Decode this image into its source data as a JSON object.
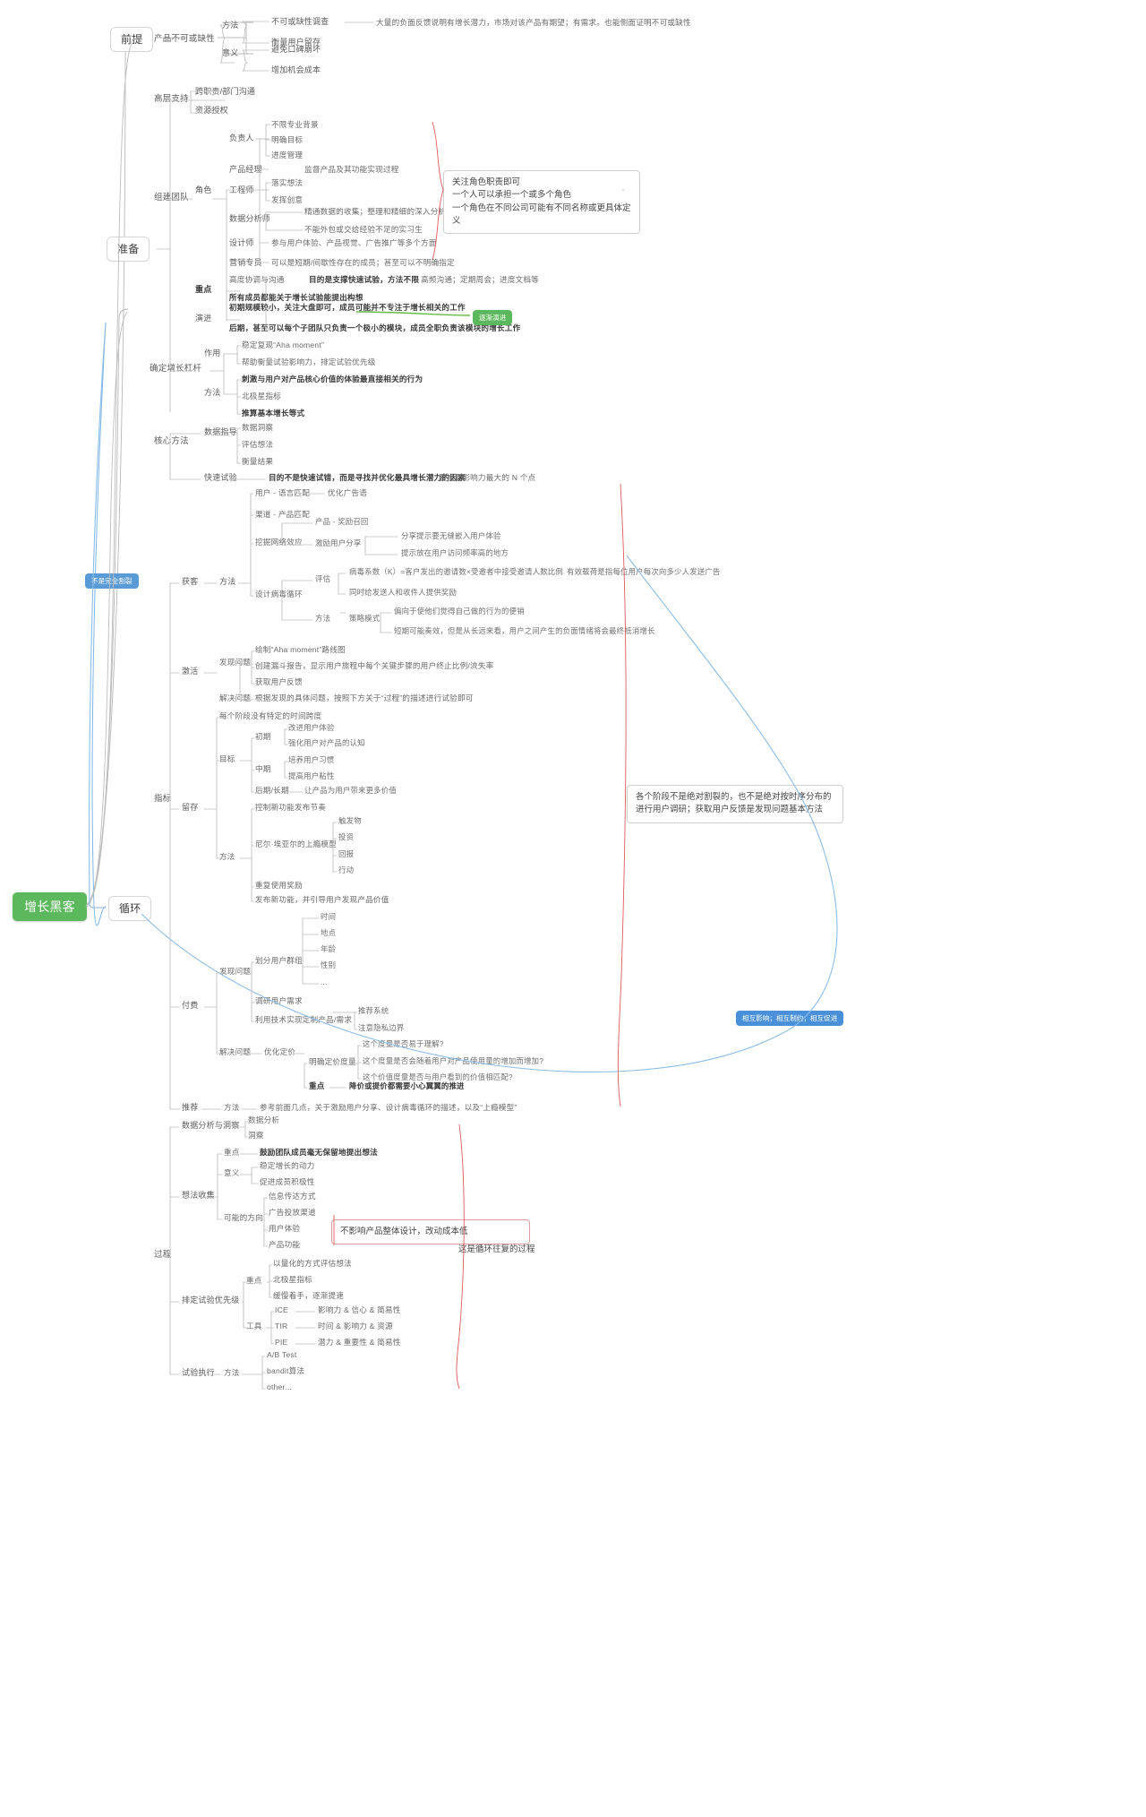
{
  "title": "增长黑客",
  "colors": {
    "root_green": "#5cb85c",
    "badge_blue": "#5b9bd5",
    "note_border": "#cfcfcf",
    "red_brace": "#e05c5c",
    "blue_curve": "#7fb6e8",
    "green_arrow": "#66bb44"
  },
  "root": {
    "label": "增长黑客"
  },
  "branches": {
    "premise": {
      "label": "前提"
    },
    "prepare": {
      "label": "准备"
    },
    "loop": {
      "label": "循环"
    }
  },
  "nodes": {
    "n_product_essential": "产品不可或缺性",
    "n_method": "方法",
    "n_survey": "不可或缺性调查",
    "n_survey_note": "大量的负面反馈说明有增长潜力，市场对该产品有期望；有需求。也能侧面证明不可或缺性",
    "n_measure_retention": "衡量用户留存",
    "n_meaning": "意义",
    "n_avoid_wom": "避免口碑崩坏",
    "n_opportunity_cost": "增加机会成本",
    "n_top_support": "高层支持",
    "n_cross_dept": "跨职责/部门沟通",
    "n_resource": "资源授权",
    "n_build_team": "组建团队",
    "n_role": "角色",
    "n_owner": "负责人",
    "n_owner_1": "不限专业背景",
    "n_owner_2": "明确目标",
    "n_owner_3": "进度管理",
    "n_pm": "产品经理",
    "n_pm_1": "监督产品及其功能实现过程",
    "n_eng": "工程师",
    "n_eng_1": "落实想法",
    "n_eng_2": "发挥创意",
    "n_data_analyst": "数据分析师",
    "n_da_1": "精通数据的收集；整理和精细的深入分析",
    "n_da_2": "不能外包或交给经验不足的实习生",
    "n_designer": "设计师",
    "n_designer_1": "参与用户体验、产品视觉、广告推广等多个方面",
    "n_marketer": "营销专员",
    "n_marketer_1": "可以是短期/间歇性存在的成员；甚至可以不明确指定",
    "n_focus": "重点",
    "n_focus_1": "高度协调与沟通",
    "n_focus_1a": "目的是支撑快速试验，方法不限",
    "n_focus_1b": "高频沟通；定期周会；进度文档等",
    "n_focus_2": "所有成员都能关于增长试验能提出构想",
    "n_evolve": "演进",
    "n_evolve_1": "初期规模较小，关注大盘即可，成员可能并不专注于增长相关的工作",
    "n_evolve_2": "后期，甚至可以每个子团队只负责一个极小的模块，成员全职负责该模块的增长工作",
    "n_growth_lever": "确定增长杠杆",
    "n_gl_role": "作用",
    "n_gl_role_1": "稳定复现“Aha moment”",
    "n_gl_role_2": "帮助衡量试验影响力，排定试验优先级",
    "n_gl_method": "方法",
    "n_gl_m_1": "刺激与用户对产品核心价值的体验最直接相关的行为",
    "n_gl_m_2": "北极星指标",
    "n_gl_m_3": "推算基本增长等式",
    "n_core_method": "核心方法",
    "n_data_guide": "数据指导",
    "n_dg_1": "数据洞察",
    "n_dg_2": "评估想法",
    "n_dg_3": "衡量结果",
    "n_fast_test": "快速试验",
    "n_ft_1": "目的不是快速试错，而是寻找并优化最具增长潜力的因素",
    "n_ft_2": "要找到影响力最大的 N 个点",
    "n_metrics": "指标",
    "n_acquire": "获客",
    "n_acq_method": "方法",
    "n_acq_1": "用户 - 语言匹配",
    "n_acq_1a": "优化广告语",
    "n_acq_2": "渠道 - 产品匹配",
    "n_acq_3": "挖掘网络效应",
    "n_acq_3a": "产品 - 奖励召回",
    "n_acq_3b": "激励用户分享",
    "n_acq_3b1": "分享提示要无缝嵌入用户体验",
    "n_acq_3b2": "提示放在用户访问频率高的地方",
    "n_acq_4": "设计病毒循环",
    "n_acq_4_eval": "评估",
    "n_acq_4_e1": "病毒系数（K）=客户发出的邀请数×受邀者中接受邀请人数比例",
    "n_acq_4_e1a": "有效载荷是指每位用户每次向多少人发送广告",
    "n_acq_4_e2": "同时给发送人和收件人提供奖励",
    "n_acq_4_m": "方法",
    "n_acq_4_m1": "策略模式",
    "n_acq_4_m1a": "偏向于使他们觉得自己做的行为的便销",
    "n_acq_4_m1b": "短期可能奏效，但是从长远来看，用户之间产生的负面情绪将会最终抵消增长",
    "n_activate": "激活",
    "n_act_find": "发现问题",
    "n_act_f1": "绘制“Aha moment”路线图",
    "n_act_f2": "创建漏斗报告，显示用户旅程中每个关键步骤的用户终止比例/流失率",
    "n_act_f3": "获取用户反馈",
    "n_act_solve": "解决问题",
    "n_act_s1": "根据发现的具体问题，按照下方关于“过程”的描述进行试验即可",
    "n_retain": "留存",
    "n_ret_nospan": "每个阶段没有特定的时间跨度",
    "n_ret_goal": "目标",
    "n_ret_g_early": "初期",
    "n_ret_g_e1": "改进用户体验",
    "n_ret_g_e2": "强化用户对产品的认知",
    "n_ret_g_mid": "中期",
    "n_ret_g_m1": "培养用户习惯",
    "n_ret_g_m2": "提高用户粘性",
    "n_ret_g_late": "后期/长期",
    "n_ret_g_l1": "让产品为用户带来更多价值",
    "n_ret_method": "方法",
    "n_ret_m1": "控制新功能发布节奏",
    "n_ret_m2": "尼尔·埃亚尔的上瘾模型",
    "n_ret_m2a": "触发物",
    "n_ret_m2b": "投资",
    "n_ret_m2c": "回报",
    "n_ret_m2d": "行动",
    "n_ret_m3": "重复使用奖励",
    "n_ret_m4": "发布新功能，并引导用户发现产品价值",
    "n_pay": "付费",
    "n_pay_find": "发现问题",
    "n_pay_f1": "划分用户群组",
    "n_pay_f1a": "时间",
    "n_pay_f1b": "地点",
    "n_pay_f1c": "年龄",
    "n_pay_f1d": "性别",
    "n_pay_f1e": "...",
    "n_pay_f2": "调研用户需求",
    "n_pay_f3": "利用技术实现定制产品/需求",
    "n_pay_f3a": "推荐系统",
    "n_pay_f3b": "注意隐私边界",
    "n_pay_solve": "解决问题",
    "n_pay_s1": "优化定价",
    "n_pay_s1a": "明确定价度量",
    "n_pay_s1a1": "这个度量是否易于理解?",
    "n_pay_s1a2": "这个度量是否会随着用户对产品使用量的增加而增加?",
    "n_pay_s1a3": "这个价值度量是否与用户看到的价值相匹配?",
    "n_pay_s1_focus": "重点",
    "n_pay_s1_focus1": "降价或提价都需要小心翼翼的推进",
    "n_recommend": "推荐",
    "n_rec_method": "方法",
    "n_rec_m1": "参考前面几点，关于激励用户分享、设计病毒循环的描述，以及“上瘾模型”",
    "n_process": "过程",
    "n_proc_analyze": "数据分析与洞察",
    "n_proc_a1": "数据分析",
    "n_proc_a2": "洞察",
    "n_idea": "想法收集",
    "n_idea_focus": "重点",
    "n_idea_focus1": "鼓励团队成员毫无保留地提出想法",
    "n_idea_meaning": "意义",
    "n_idea_m1": "稳定增长的动力",
    "n_idea_m2": "促进成员积极性",
    "n_idea_dir": "可能的方向",
    "n_idea_d1": "信息传达方式",
    "n_idea_d2": "广告投放渠道",
    "n_idea_d3": "用户体验",
    "n_idea_d4": "产品功能",
    "n_prior": "排定试验优先级",
    "n_prior_focus": "重点",
    "n_prior_f1": "以量化的方式评估想法",
    "n_prior_f2": "北极星指标",
    "n_prior_f3": "缓慢着手，逐渐提速",
    "n_prior_tool": "工具",
    "n_prior_t1": "ICE",
    "n_prior_t1a": "影响力 & 信心 & 简易性",
    "n_prior_t2": "TIR",
    "n_prior_t2a": "时间 & 影响力 & 资源",
    "n_prior_t3": "PIE",
    "n_prior_t3a": "潜力 & 重要性 & 简易性",
    "n_exec": "试验执行",
    "n_exec_method": "方法",
    "n_exec_m1": "A/B Test",
    "n_exec_m2": "bandit算法",
    "n_exec_m3": "other..."
  },
  "notes": {
    "role_note": "关注角色职责即可\n一个人可以承担一个或多个角色\n一个角色在不同公司可能有不同名称或更具体定义",
    "stage_note": "各个阶段不是绝对割裂的，也不是绝对按时序分布的\n进行用户调研；获取用户反馈是发现问题基本方法",
    "design_note": "不影响产品整体设计，改动成本低",
    "cycle_note": "这是循环往复的过程"
  },
  "badges": {
    "gradual": "逐渐演进",
    "not_fully_split": "不是完全割裂",
    "mutual": "相互影响；相互制约；相互促进"
  }
}
